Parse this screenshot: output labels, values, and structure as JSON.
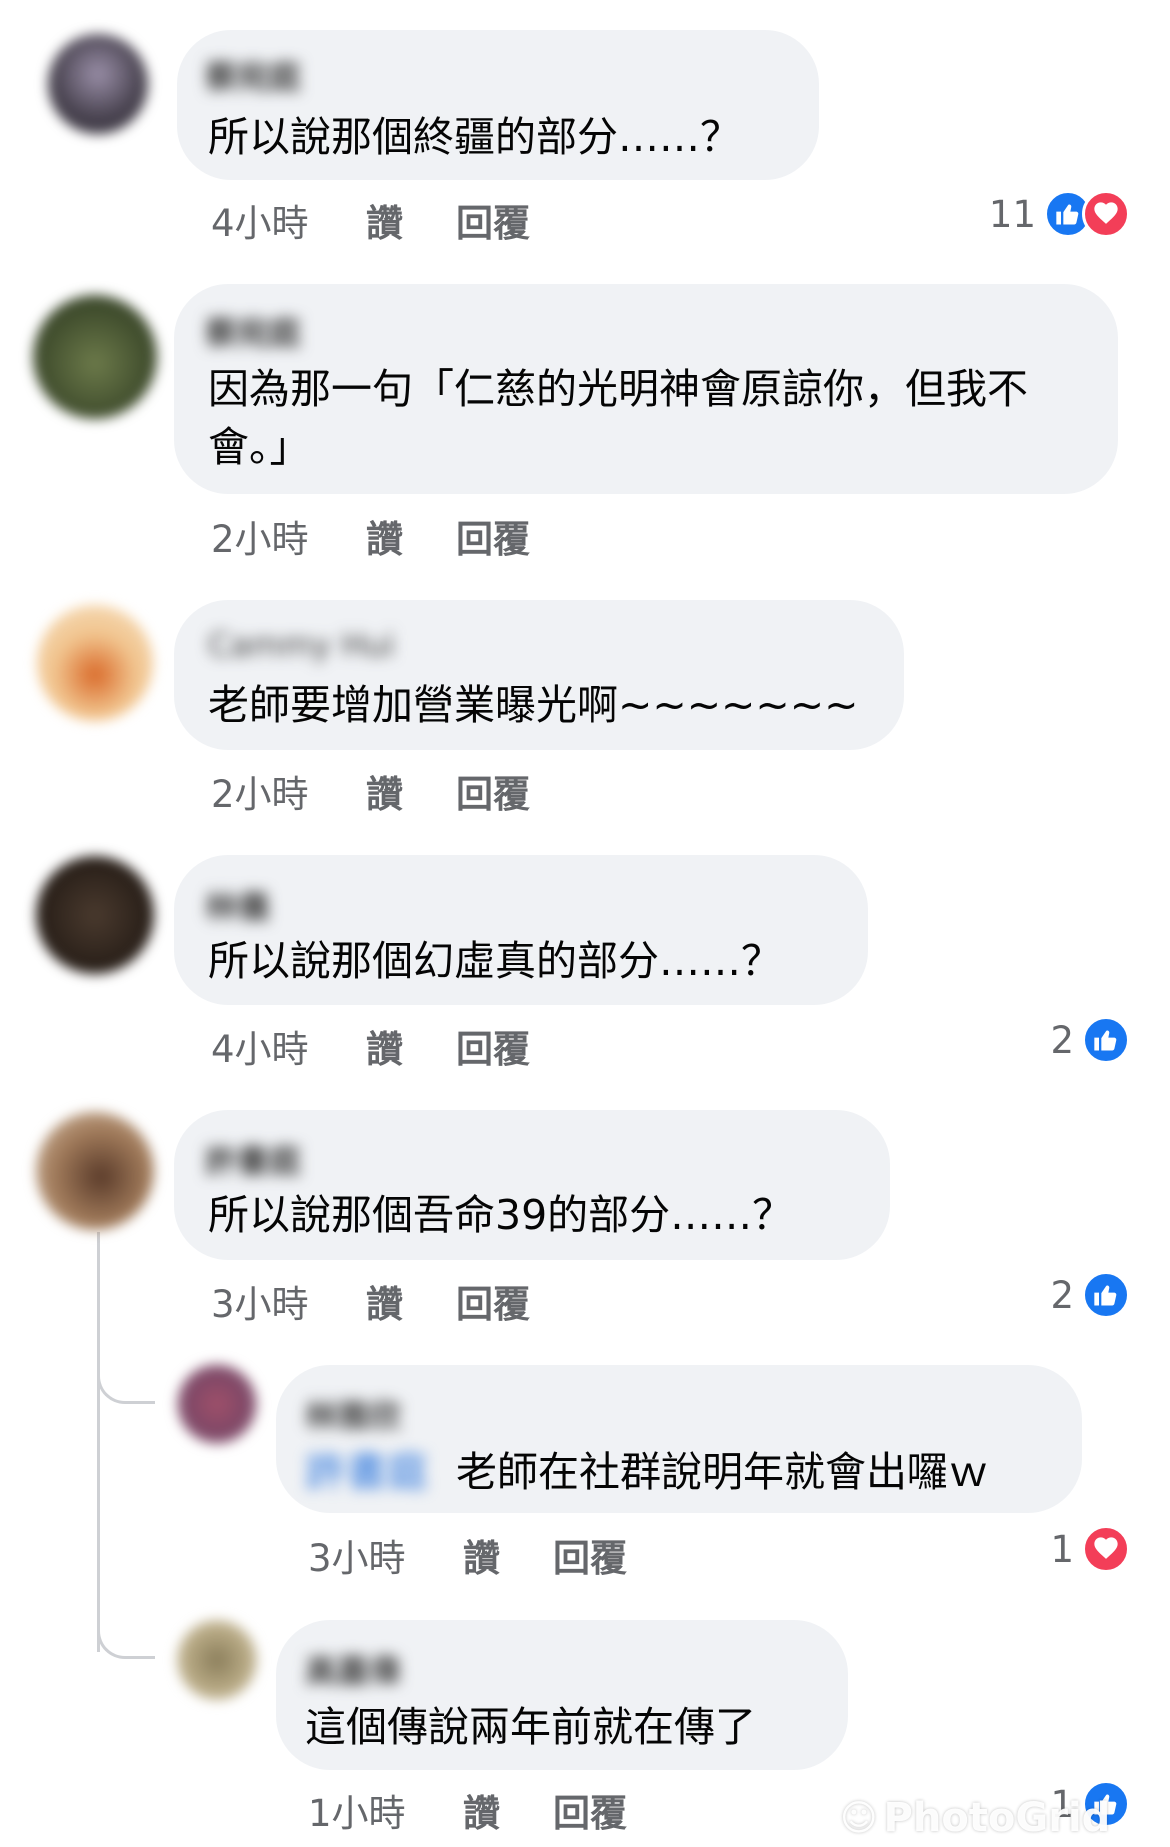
{
  "colors": {
    "bubble": "#f0f2f5",
    "like": "#1877f2",
    "love": "#f33e58",
    "meta": "#65676b",
    "mention": "#216fdb"
  },
  "actions": {
    "like_label": "讚",
    "reply_label": "回覆"
  },
  "comments": [
    {
      "author": "蔡宛庭",
      "text": "所以說那個終疆的部分……？",
      "time": "4小時",
      "reaction_count": "11",
      "reactions": [
        "like-icon",
        "love-icon"
      ]
    },
    {
      "author": "蔡宛庭",
      "text": "因為那一句「仁慈的光明神會原諒你，但我不會。」",
      "time": "2小時"
    },
    {
      "author": "Cammy Hui",
      "text": "老師要增加營業曝光啊~~~~~~~",
      "time": "2小時"
    },
    {
      "author": "林儀",
      "text": "所以說那個幻虛真的部分……？",
      "time": "4小時",
      "reaction_count": "2",
      "reactions": [
        "like-icon"
      ]
    },
    {
      "author": "許書庭",
      "text": "所以說那個吾命39的部分……？",
      "time": "3小時",
      "reaction_count": "2",
      "reactions": [
        "like-icon"
      ],
      "replies": [
        {
          "author": "林雅欣",
          "mention": "許書庭",
          "text": "老師在社群說明年就會出囉ｗ",
          "time": "3小時",
          "reaction_count": "1",
          "reactions": [
            "love-icon"
          ]
        },
        {
          "author": "高嘉偉",
          "text": "這個傳說兩年前就在傳了",
          "time": "1小時",
          "reaction_count": "1",
          "reactions": [
            "like-icon"
          ]
        }
      ]
    }
  ],
  "watermark": {
    "icon": "photogrid-logo-icon",
    "text": "PhotoGrid"
  }
}
